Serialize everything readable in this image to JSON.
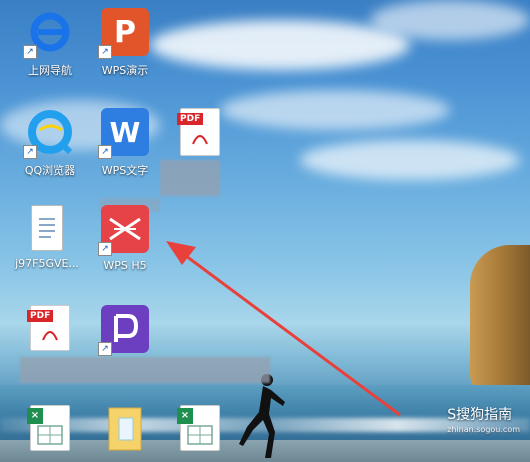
{
  "icons": [
    {
      "label": "上网导航",
      "icon": "ie-icon"
    },
    {
      "label": "WPS演示",
      "icon": "wps-presentation-icon"
    },
    {
      "label": "QQ浏览器",
      "icon": "qq-browser-icon"
    },
    {
      "label": "WPS文字",
      "icon": "wps-writer-icon"
    },
    {
      "label": "",
      "icon": "pdf-file-icon"
    },
    {
      "label": "j97F5GVE...",
      "icon": "text-document-icon"
    },
    {
      "label": "WPS H5",
      "icon": "wps-h5-icon"
    },
    {
      "label": "",
      "icon": "pdf-file-icon"
    },
    {
      "label": "",
      "icon": "pdf-reader-icon"
    },
    {
      "label": "",
      "icon": "excel-icon"
    },
    {
      "label": "",
      "icon": "folder-icon"
    },
    {
      "label": "",
      "icon": "excel-icon"
    }
  ],
  "tile_text": {
    "wps_present": "P",
    "wps_writer": "W",
    "pdf_badge": "PDF",
    "pdf_badge2": "PDF"
  },
  "watermark": {
    "title": "S搜狗指南",
    "url": "zhinan.sogou.com"
  },
  "colors": {
    "arrow": "#e8413b",
    "wps_orange": "#e2552b",
    "wps_blue": "#2d7ee0",
    "wps_h5_red": "#e54347",
    "pdf_purple": "#6b3fc0"
  }
}
